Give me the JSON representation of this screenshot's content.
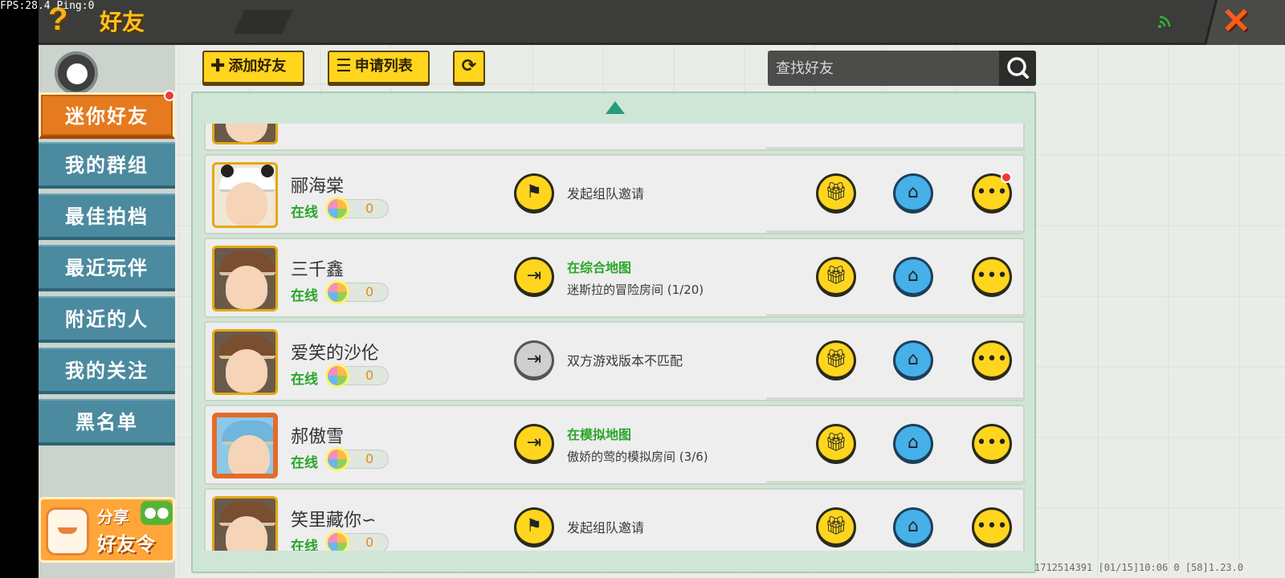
{
  "debug": {
    "fps_text": "FPS:28.4  Ping:0"
  },
  "header": {
    "title": "好友",
    "help_icon": "?",
    "close_icon": "✕"
  },
  "sidebar": {
    "items": [
      {
        "label": "迷你好友",
        "active": true,
        "badge": true
      },
      {
        "label": "我的群组",
        "active": false
      },
      {
        "label": "最佳拍档",
        "active": false
      },
      {
        "label": "最近玩伴",
        "active": false
      },
      {
        "label": "附近的人",
        "active": false
      },
      {
        "label": "我的关注",
        "active": false
      },
      {
        "label": "黑名单",
        "active": false
      }
    ],
    "share": {
      "line1": "分享",
      "line2": "好友令"
    }
  },
  "toolbar": {
    "add_friend_label": "添加好友",
    "request_list_label": "申请列表",
    "refresh_icon": "refresh-icon"
  },
  "search": {
    "placeholder": "查找好友"
  },
  "friends": [
    {
      "name": "郦海棠",
      "status": "在线",
      "score": "0",
      "action_icon": "flag-icon",
      "action_state": "active",
      "action_line1": "发起组队邀请",
      "action_line2": "",
      "chat_badge": true
    },
    {
      "name": "三千鑫",
      "status": "在线",
      "score": "0",
      "action_icon": "enter-icon",
      "action_state": "active",
      "action_line1": "在综合地图",
      "action_line2": "迷斯拉的冒险房间 (1/20)",
      "chat_badge": false
    },
    {
      "name": "爱笑的沙伦",
      "status": "在线",
      "score": "0",
      "action_icon": "enter-icon",
      "action_state": "disabled",
      "action_line1": "双方游戏版本不匹配",
      "action_line2": "",
      "chat_badge": false
    },
    {
      "name": "郝傲雪",
      "status": "在线",
      "score": "0",
      "action_icon": "enter-icon",
      "action_state": "active",
      "action_line1": "在模拟地图",
      "action_line2": "傲娇的莺的模拟房间 (3/6)",
      "chat_badge": false
    },
    {
      "name": "笑里藏你∽",
      "status": "在线",
      "score": "0",
      "action_icon": "flag-icon",
      "action_state": "active",
      "action_line1": "发起组队邀请",
      "action_line2": "",
      "chat_badge": false
    }
  ],
  "build_info": "1712514391   [01/15]10:06 0   [58]1.23.0",
  "colors": {
    "accent": "#ffd51e",
    "active_tab": "#e57a1f",
    "tab": "#4b8a9f",
    "online": "#2aa52a",
    "home_button": "#45b1e8"
  }
}
